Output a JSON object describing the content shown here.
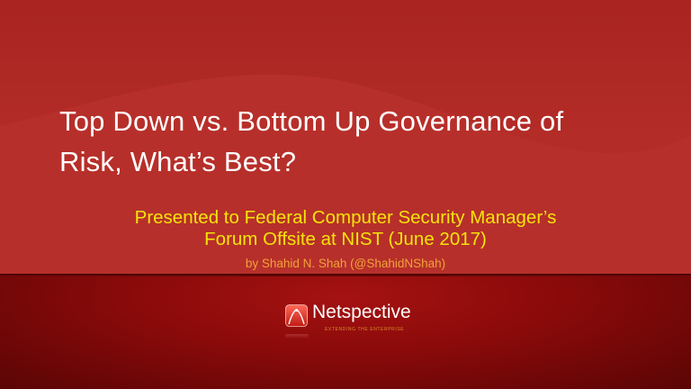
{
  "slide": {
    "title_lines": [
      "Top Down vs. Bottom Up Governance of",
      "Risk, What’s Best?"
    ],
    "subtitle_lines": [
      "Presented to Federal Computer Security Manager’s",
      "Forum Offsite at NIST (June 2017)"
    ],
    "byline": "by Shahid N. Shah (@ShahidNShah)"
  },
  "logo": {
    "name": "Netspective",
    "tagline": "EXTENDING THE ENTERPRISE"
  },
  "colors": {
    "background": "#b02a26",
    "subtitle": "#f4e40a",
    "byline": "#f0a23a",
    "band": "#8a0a0a"
  }
}
